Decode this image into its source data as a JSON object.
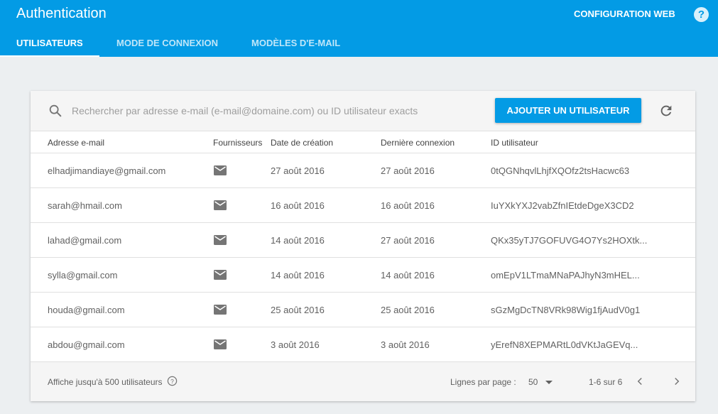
{
  "header": {
    "title": "Authentication",
    "config_link": "CONFIGURATION WEB",
    "help_icon": "help-circle-icon",
    "help_glyph": "?"
  },
  "tabs": [
    {
      "label": "UTILISATEURS",
      "active": true
    },
    {
      "label": "MODE DE CONNEXION",
      "active": false
    },
    {
      "label": "MODÈLES D'E-MAIL",
      "active": false
    }
  ],
  "search": {
    "placeholder": "Rechercher par adresse e-mail (e-mail@domaine.com) ou ID utilisateur exacts",
    "icon": "search-icon"
  },
  "toolbar": {
    "add_user_label": "AJOUTER UN UTILISATEUR",
    "refresh_icon": "refresh-icon"
  },
  "table": {
    "columns": [
      "Adresse e-mail",
      "Fournisseurs",
      "Date de création",
      "Dernière connexion",
      "ID utilisateur"
    ],
    "rows": [
      {
        "email": "elhadjimandiaye@gmail.com",
        "provider": "email-icon",
        "created": "27 août 2016",
        "last_login": "27 août 2016",
        "uid": "0tQGNhqvlLhjfXQOfz2tsHacwc63"
      },
      {
        "email": "sarah@hmail.com",
        "provider": "email-icon",
        "created": "16 août 2016",
        "last_login": "16 août 2016",
        "uid": "IuYXkYXJ2vabZfnIEtdeDgeX3CD2"
      },
      {
        "email": "lahad@gmail.com",
        "provider": "email-icon",
        "created": "14 août 2016",
        "last_login": "27 août 2016",
        "uid": "QKx35yTJ7GOFUVG4O7Ys2HOXtk..."
      },
      {
        "email": "sylla@gmail.com",
        "provider": "email-icon",
        "created": "14 août 2016",
        "last_login": "14 août 2016",
        "uid": "omEpV1LTmaMNaPAJhyN3mHEL..."
      },
      {
        "email": "houda@gmail.com",
        "provider": "email-icon",
        "created": "25 août 2016",
        "last_login": "25 août 2016",
        "uid": "sGzMgDcTN8VRk98Wig1fjAudV0g1"
      },
      {
        "email": "abdou@gmail.com",
        "provider": "email-icon",
        "created": "3 août 2016",
        "last_login": "3 août 2016",
        "uid": "yErefN8XEPMARtL0dVKtJaGEVq..."
      }
    ]
  },
  "footer": {
    "limit_text": "Affiche jusqu'à 500 utilisateurs",
    "rows_per_page_label": "Lignes par page :",
    "rows_per_page_value": "50",
    "range_text": "1-6 sur 6"
  },
  "colors": {
    "primary": "#039be5",
    "background": "#eceff1"
  }
}
